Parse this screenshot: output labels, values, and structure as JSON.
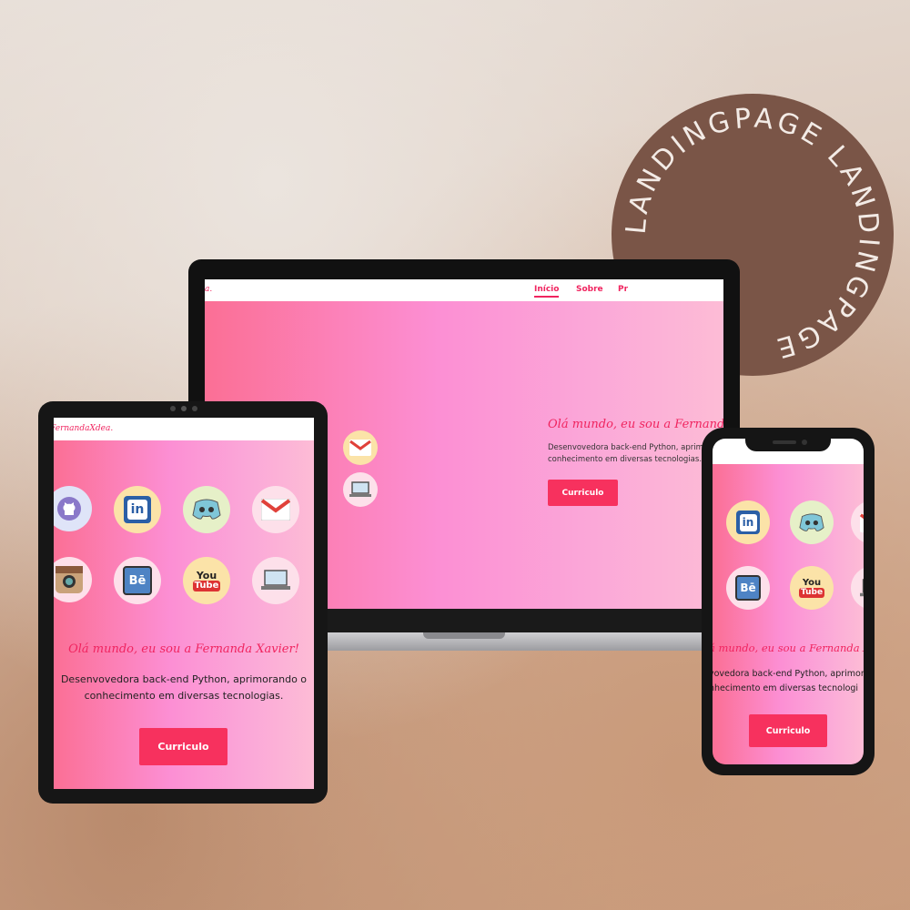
{
  "badge": {
    "text": "LANDINGPAGE  LANDINGPAGE  "
  },
  "site": {
    "logo": "FernandaXdea.",
    "logo_partial": "a.",
    "nav": {
      "inicio": "Início",
      "sobre": "Sobre",
      "p": "Pr"
    },
    "headline": "Olá mundo, eu sou a Fernanda Xavier!",
    "headline_laptop": "Olá mundo, eu sou a Fernanda X",
    "headline_phone": "á mundo, eu sou a Fernanda Xav",
    "desc_line1": "Desenvovedora back-end Python, aprimorando o",
    "desc_line2": "conhecimento em diversas tecnologias.",
    "desc_laptop1": "Desenvovedora back-end Python, aprim",
    "desc_laptop2": "conhecimento em diversas tecnologias.",
    "desc_phone1": "vovedora back-end Python, aprimor",
    "desc_phone2": "nhecimento em diversas tecnologi",
    "button": "Curriculo",
    "icons": {
      "linkedin": "in",
      "behance": "Bē",
      "youtube_top": "You",
      "youtube_bottom": "Tube"
    }
  },
  "colors": {
    "accent": "#f7315e",
    "badge": "#7a5547",
    "text_pink": "#f0245f"
  }
}
